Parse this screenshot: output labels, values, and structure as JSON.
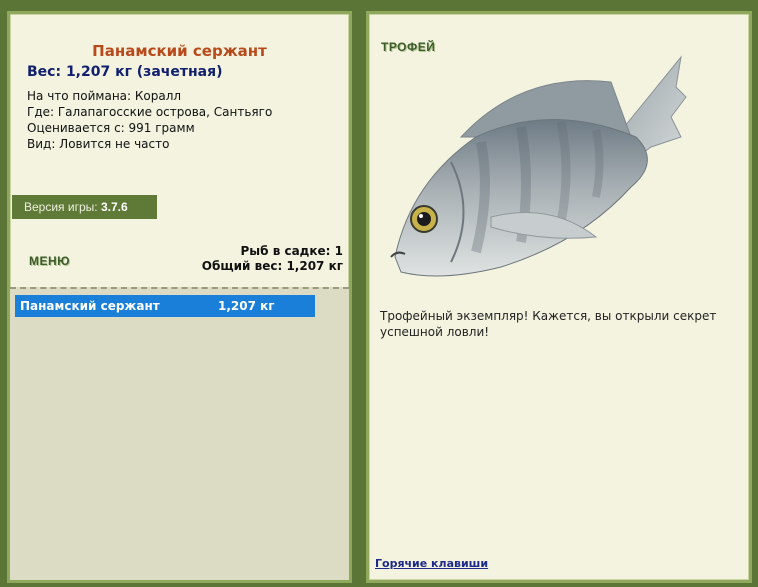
{
  "fish": {
    "name": "Панамский сержант",
    "weight_line": "Вес: 1,207 кг (зачетная)",
    "info": [
      "На что поймана: Коралл",
      "Где: Галапагосские острова, Сантьяго",
      "Оценивается с: 991 грамм",
      "Вид: Ловится не часто"
    ]
  },
  "version": {
    "label": "Версия игры:",
    "value": "3.7.6"
  },
  "menu_label": "МЕНЮ",
  "net": {
    "count_line": "Рыб в садке: 1",
    "total_line": "Общий вес: 1,207 кг",
    "rows": [
      {
        "name": "Панамский сержант",
        "weight": "1,207 кг"
      }
    ]
  },
  "trophy": {
    "label": "ТРОФЕЙ",
    "text": "Трофейный экземпляр! Кажется, вы открыли секрет успешной ловли!"
  },
  "hotkeys_label": "Горячие клавиши",
  "colors": {
    "background": "#5a7536",
    "panel": "#f3f3df",
    "selection": "#1a7fd8",
    "title": "#b8491a"
  }
}
